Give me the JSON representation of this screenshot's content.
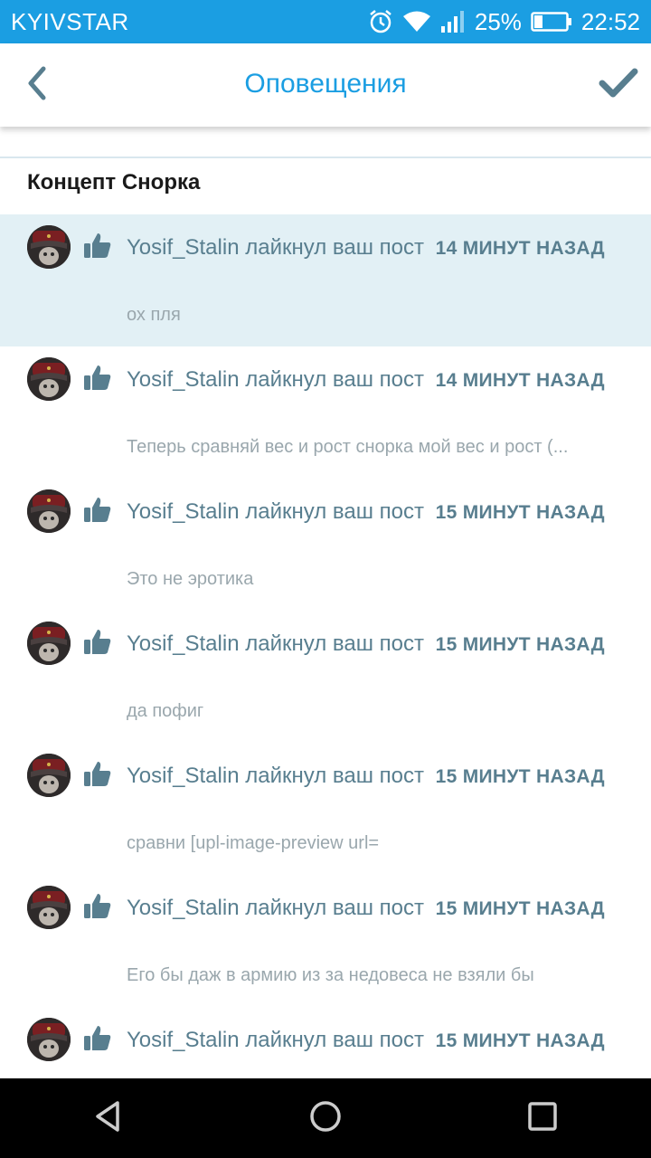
{
  "status_bar": {
    "carrier": "KYIVSTAR",
    "battery": "25%",
    "time": "22:52",
    "icons": [
      "alarm-icon",
      "wifi-icon",
      "signal-icon",
      "battery-icon"
    ]
  },
  "header": {
    "title": "Оповещения",
    "back_icon": "chevron-left-icon",
    "done_icon": "checkmark-icon"
  },
  "colors": {
    "accent": "#1b9ee2",
    "text_muted": "#587e8f",
    "preview": "#9aa7ad",
    "highlight_bg": "#e2f0f5"
  },
  "group": {
    "title": "Концепт Снорка"
  },
  "notifications": [
    {
      "user": "Yosif_Stalin",
      "action": "лайкнул ваш пост",
      "time": "14 МИНУТ НАЗАД",
      "preview": "ох пля",
      "highlighted": true
    },
    {
      "user": "Yosif_Stalin",
      "action": "лайкнул ваш пост",
      "time": "14 МИНУТ НАЗАД",
      "preview": "Теперь сравняй вес и рост снорка мой вес и рост (...",
      "highlighted": false
    },
    {
      "user": "Yosif_Stalin",
      "action": "лайкнул ваш пост",
      "time": "15 МИНУТ НАЗАД",
      "preview": "Это не эротика",
      "highlighted": false
    },
    {
      "user": "Yosif_Stalin",
      "action": "лайкнул ваш пост",
      "time": "15 МИНУТ НАЗАД",
      "preview": "да пофиг",
      "highlighted": false
    },
    {
      "user": "Yosif_Stalin",
      "action": "лайкнул ваш пост",
      "time": "15 МИНУТ НАЗАД",
      "preview": "сравни [upl-image-preview url=",
      "highlighted": false
    },
    {
      "user": "Yosif_Stalin",
      "action": "лайкнул ваш пост",
      "time": "15 МИНУТ НАЗАД",
      "preview": "Его бы даж в армию из за недовеса не взяли бы",
      "highlighted": false
    },
    {
      "user": "Yosif_Stalin",
      "action": "лайкнул ваш пост",
      "time": "15 МИНУТ НАЗАД",
      "preview": "",
      "highlighted": false
    }
  ],
  "nav_bar": {
    "buttons": [
      "back-triangle-icon",
      "home-circle-icon",
      "recents-square-icon"
    ]
  }
}
